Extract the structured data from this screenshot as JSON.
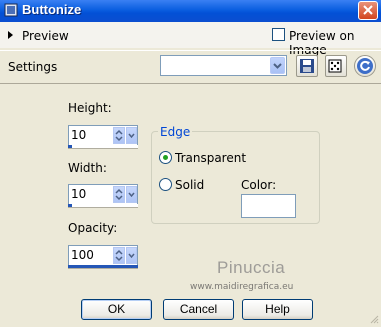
{
  "window": {
    "title": "Buttonize"
  },
  "preview": {
    "label": "Preview",
    "on_image_label": "Preview on Image",
    "on_image_checked": false
  },
  "settings": {
    "label": "Settings",
    "selected": ""
  },
  "fields": {
    "height": {
      "label": "Height:",
      "value": "10"
    },
    "width": {
      "label": "Width:",
      "value": "10"
    },
    "opacity": {
      "label": "Opacity:",
      "value": "100"
    }
  },
  "edge": {
    "title": "Edge",
    "options": [
      "Transparent",
      "Solid"
    ],
    "selected": "Transparent",
    "color_label": "Color:",
    "color_value": "#ffffff"
  },
  "watermark": {
    "name": "Pinuccia",
    "url": "www.maidiregrafica.eu"
  },
  "buttons": {
    "ok": "OK",
    "cancel": "Cancel",
    "help": "Help"
  },
  "colors": {
    "titlebar": "#0a5ee0",
    "accent": "#0046d5",
    "radio_dot": "#21a121",
    "close": "#d2451f"
  }
}
